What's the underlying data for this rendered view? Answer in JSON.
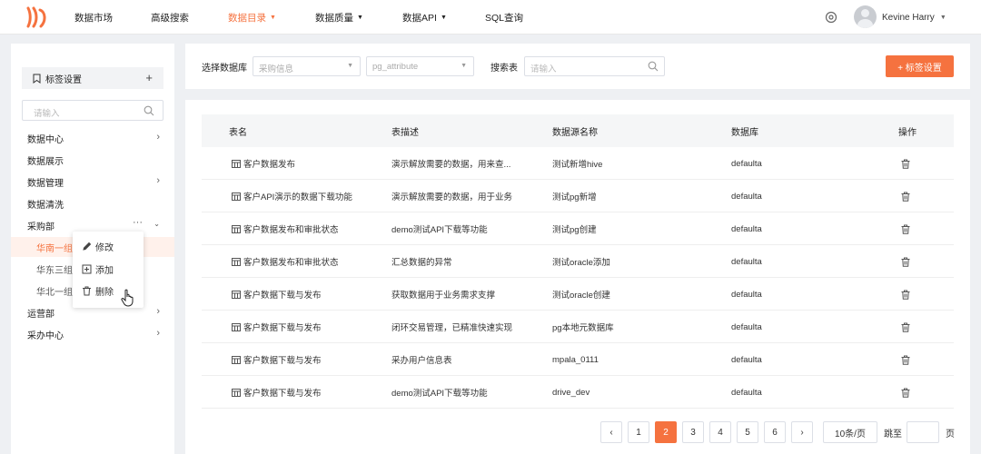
{
  "header": {
    "nav": [
      {
        "label": "数据市场",
        "active": false,
        "dropdown": false
      },
      {
        "label": "高级搜索",
        "active": false,
        "dropdown": false
      },
      {
        "label": "数据目录",
        "active": true,
        "dropdown": true
      },
      {
        "label": "数据质量",
        "active": false,
        "dropdown": true
      },
      {
        "label": "数据API",
        "active": false,
        "dropdown": true
      },
      {
        "label": "SQL查询",
        "active": false,
        "dropdown": false
      }
    ],
    "username": "Kevine Harry",
    "accent_color": "#f5723f"
  },
  "sidebar": {
    "title": "标签设置",
    "add_icon": "+",
    "search_placeholder": "请输入",
    "items": [
      {
        "label": "数据中心",
        "expandable": true
      },
      {
        "label": "数据展示",
        "expandable": false
      },
      {
        "label": "数据管理",
        "expandable": true
      },
      {
        "label": "数据清洗",
        "expandable": false
      },
      {
        "label": "采购部",
        "expandable": true,
        "expanded": true
      },
      {
        "label": "华南一组",
        "sub": true,
        "selected": true
      },
      {
        "label": "华东三组",
        "sub": true
      },
      {
        "label": "华北一组",
        "sub": true
      },
      {
        "label": "运营部",
        "expandable": true
      },
      {
        "label": "采办中心",
        "expandable": true
      }
    ],
    "context_menu": [
      {
        "label": "修改",
        "icon": "edit-icon"
      },
      {
        "label": "添加",
        "icon": "add-square-icon"
      },
      {
        "label": "删除",
        "icon": "trash-icon"
      }
    ]
  },
  "filter": {
    "db_label": "选择数据库",
    "db_value": "采购信息",
    "table_value": "pg_attribute",
    "search_label": "搜索表",
    "search_placeholder": "请输入",
    "tag_button": "+ 标签设置"
  },
  "table": {
    "columns": [
      "表名",
      "表描述",
      "数据源名称",
      "数据库",
      "操作"
    ],
    "rows": [
      {
        "name": "客户数据发布",
        "desc": "演示解放需要的数据，用来查...",
        "source": "测试新增hive",
        "db": "defaulta"
      },
      {
        "name": "客户API演示的数据下载功能",
        "desc": "演示解放需要的数据，用于业务",
        "source": "测试pg新增",
        "db": "defaulta"
      },
      {
        "name": "客户数据发布和审批状态",
        "desc": "demo测试API下载等功能",
        "source": "测试pg创建",
        "db": "defaulta"
      },
      {
        "name": "客户数据发布和审批状态",
        "desc": "汇总数据的异常",
        "source": "测试oracle添加",
        "db": "defaulta"
      },
      {
        "name": "客户数据下载与发布",
        "desc": "获取数据用于业务需求支撑",
        "source": "测试oracle创建",
        "db": "defaulta"
      },
      {
        "name": "客户数据下载与发布",
        "desc": "闭环交易管理，已精准快速实现",
        "source": "pg本地元数据库",
        "db": "defaulta"
      },
      {
        "name": "客户数据下载与发布",
        "desc": "采办用户信息表",
        "source": "mpala_0111",
        "db": "defaulta"
      },
      {
        "name": "客户数据下载与发布",
        "desc": "demo测试API下载等功能",
        "source": "drive_dev",
        "db": "defaulta"
      }
    ]
  },
  "pagination": {
    "prev": "‹",
    "next": "›",
    "pages": [
      "1",
      "2",
      "3",
      "4",
      "5",
      "6"
    ],
    "current": "2",
    "page_size": "10条/页",
    "goto_label": "跳至",
    "page_unit": "页"
  }
}
